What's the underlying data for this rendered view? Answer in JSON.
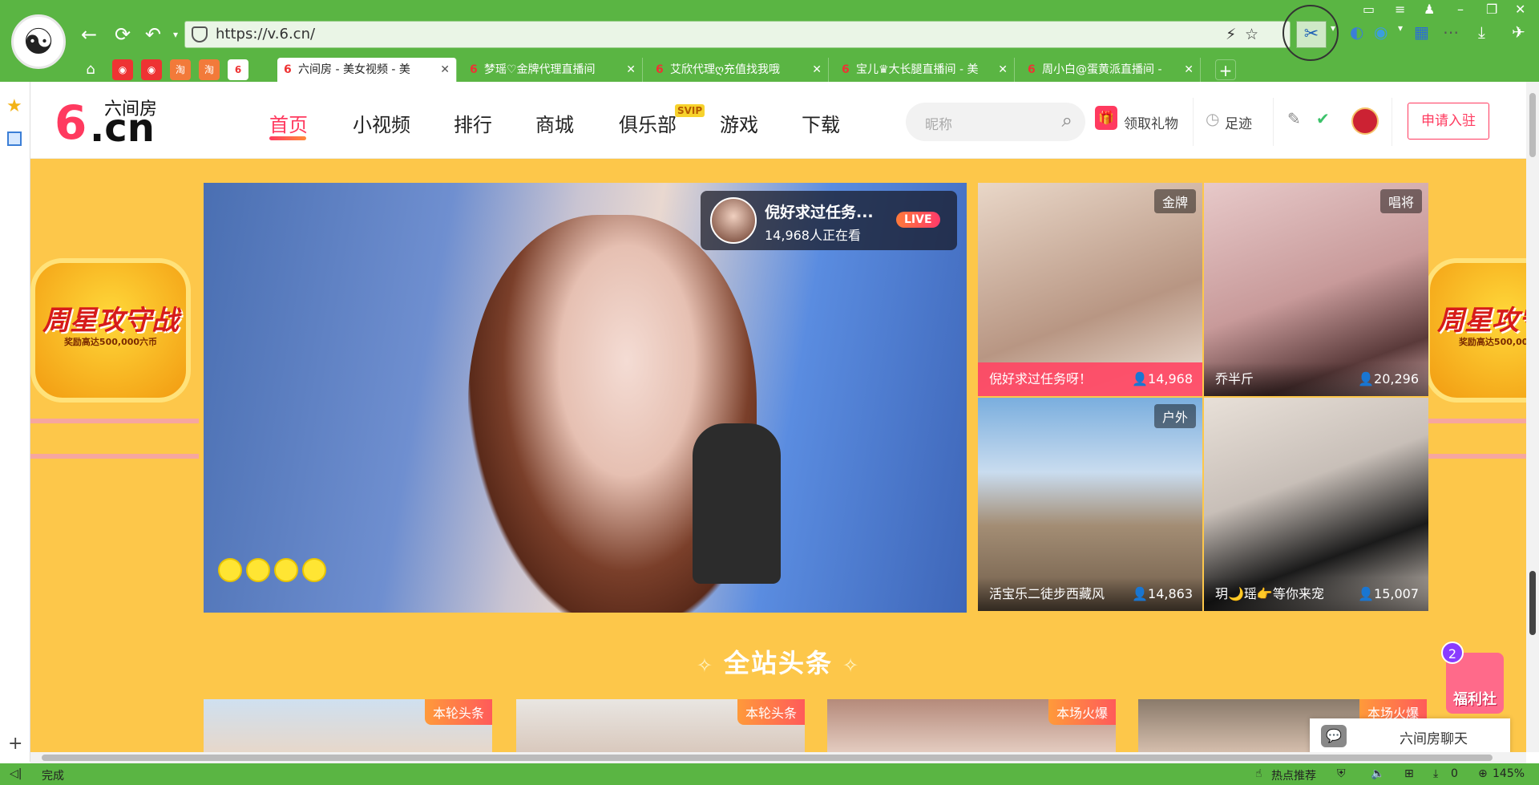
{
  "browser": {
    "url": "https://v.6.cn/",
    "tabs": [
      {
        "label": "六间房 - 美女视频 - 美",
        "active": true
      },
      {
        "label": "梦瑶♡金牌代理直播间",
        "active": false
      },
      {
        "label": "艾欣代理ღ充值找我哦",
        "active": false
      },
      {
        "label": "宝儿♛大长腿直播间 - 美",
        "active": false
      },
      {
        "label": "周小白@蛋黄派直播间 -",
        "active": false
      }
    ],
    "small_tabs": [
      "淘",
      "淘"
    ],
    "status": "完成",
    "status_right": {
      "hot": "热点推荐",
      "count": "0",
      "zoom": "145%"
    }
  },
  "site": {
    "logo_text": "六间房",
    "logo_six": "6",
    "logo_cn": ".cn",
    "nav": [
      "首页",
      "小视频",
      "排行",
      "商城",
      "俱乐部",
      "游戏",
      "下载"
    ],
    "svip": "SVIP",
    "search_placeholder": "昵称",
    "gift": "领取礼物",
    "footprint": "足迹",
    "apply": "申请入驻"
  },
  "banner": {
    "text": "周星攻守战",
    "sub": "奖励高达500,000六币"
  },
  "player": {
    "streamer": "倪好求过任务...",
    "viewers": "14,968人正在看",
    "live": "LIVE"
  },
  "thumbs": [
    {
      "name": "倪好求过任务呀！",
      "count": "14,968",
      "tag": "金牌"
    },
    {
      "name": "乔半斤",
      "count": "20,296",
      "tag": "唱将"
    },
    {
      "name": "活宝乐二徒步西藏风",
      "count": "14,863",
      "tag": "户外"
    },
    {
      "name": "玥🌙瑶👉等你来宠",
      "count": "15,007",
      "tag": ""
    }
  ],
  "section": {
    "title": "全站头条"
  },
  "cards": [
    {
      "tag": "本轮头条"
    },
    {
      "tag": "本轮头条"
    },
    {
      "tag": "本场火爆"
    },
    {
      "tag": "本场火爆"
    }
  ],
  "welfare": {
    "count": "2",
    "label": "福利社"
  },
  "chat": {
    "label": "六间房聊天"
  },
  "colors": {
    "browser_green": "#5ab543",
    "brand_pink": "#ff3a5f",
    "page_yellow": "#fdc74a"
  }
}
